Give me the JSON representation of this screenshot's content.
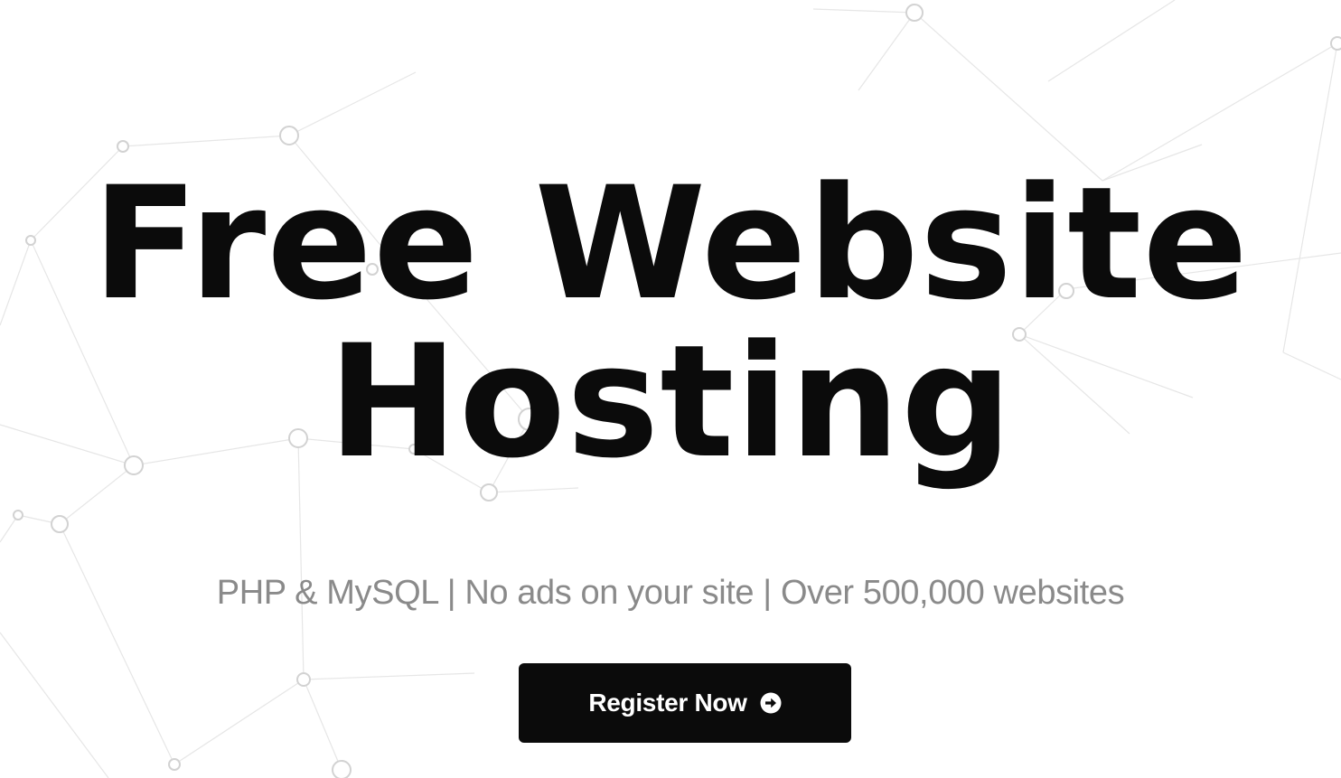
{
  "hero": {
    "title_line1": "Free Website",
    "title_line2": "Hosting",
    "tagline": "PHP & MySQL | No ads on your site | Over 500,000 websites"
  },
  "cta": {
    "label": "Register Now",
    "icon": "arrow-circle-right-icon"
  },
  "colors": {
    "background": "#ffffff",
    "text": "#0b0b0b",
    "tagline": "#8a8a8a",
    "button": "#0b0b0b",
    "button_text": "#ffffff"
  }
}
